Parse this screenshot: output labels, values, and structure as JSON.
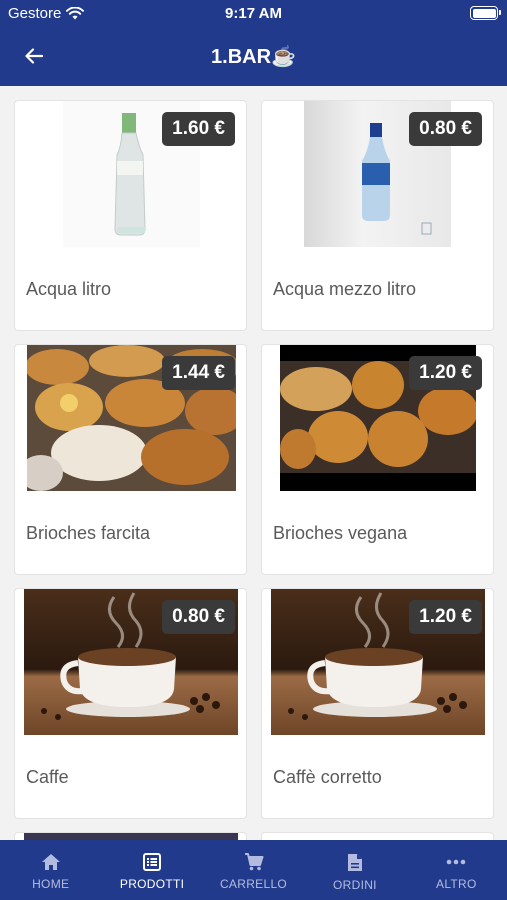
{
  "status_bar": {
    "carrier": "Gestore",
    "time": "9:17 AM"
  },
  "header": {
    "title": "1.BAR☕"
  },
  "products": [
    {
      "name": "Acqua litro",
      "price": "1.60 €"
    },
    {
      "name": "Acqua mezzo litro",
      "price": "0.80 €"
    },
    {
      "name": "Brioches farcita",
      "price": "1.44 €"
    },
    {
      "name": "Brioches vegana",
      "price": "1.20 €"
    },
    {
      "name": "Caffe",
      "price": "0.80 €"
    },
    {
      "name": "Caffè corretto",
      "price": "1.20 €"
    }
  ],
  "tabbar": {
    "tabs": [
      {
        "label": "HOME",
        "icon": "home-icon"
      },
      {
        "label": "PRODOTTI",
        "icon": "list-icon"
      },
      {
        "label": "CARRELLO",
        "icon": "cart-icon"
      },
      {
        "label": "ORDINI",
        "icon": "document-icon"
      },
      {
        "label": "ALTRO",
        "icon": "more-icon"
      }
    ],
    "active_index": 1
  },
  "colors": {
    "primary": "#223a8c",
    "price_badge": "#3a3a3a",
    "tab_inactive": "#b3bce0"
  }
}
